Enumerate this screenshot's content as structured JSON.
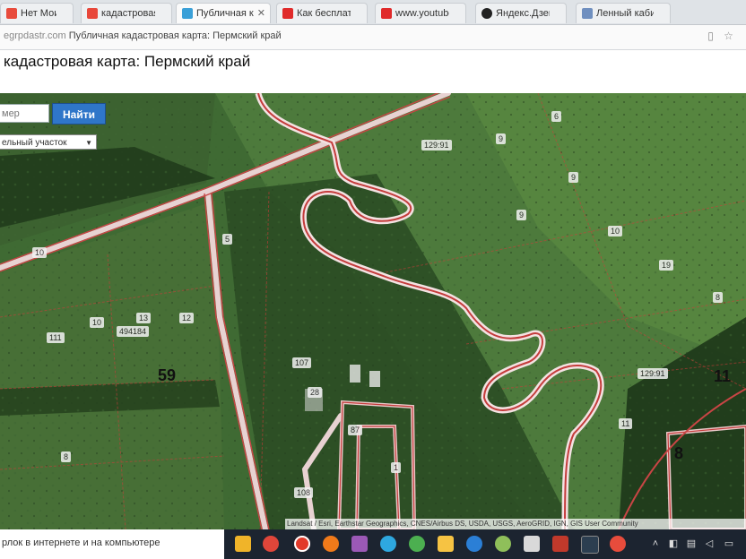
{
  "browser": {
    "tabs": [
      {
        "label": "Нет Моих Жн",
        "icon_color": "#e84b3c",
        "active": false
      },
      {
        "label": "кадастровая карта",
        "icon_color": "#e8473a",
        "active": false
      },
      {
        "label": "Публичная ка",
        "icon_color": "#3aa0d8",
        "active": true
      },
      {
        "label": "Как бесплатно",
        "icon_color": "#e02a2a",
        "active": false
      },
      {
        "label": "www.youtube.co",
        "icon_color": "#e02a2a",
        "active": false
      },
      {
        "label": "Яндекс.Дзен",
        "icon_color": "#222222",
        "active": false
      },
      {
        "label": "Ленный кабин",
        "icon_color": "#6f8fbf",
        "active": false
      }
    ],
    "url_host": "egrpdastr.com",
    "url_text": "Публичная кадастровая карта: Пермский край"
  },
  "page": {
    "title": "кадастровая карта: Пермский край"
  },
  "map": {
    "search_placeholder": "мер",
    "search_button": "Найти",
    "object_type": "ельный участок",
    "labels": [
      {
        "text": "129:91"
      },
      {
        "text": "6"
      },
      {
        "text": "9"
      },
      {
        "text": "9"
      },
      {
        "text": "9"
      },
      {
        "text": "10"
      },
      {
        "text": "19"
      },
      {
        "text": "8"
      },
      {
        "text": "5"
      },
      {
        "text": "10"
      },
      {
        "text": "13"
      },
      {
        "text": "10"
      },
      {
        "text": "494184"
      },
      {
        "text": "12"
      },
      {
        "text": "111"
      },
      {
        "text": "107"
      },
      {
        "text": "28"
      },
      {
        "text": "1"
      },
      {
        "text": "11"
      },
      {
        "text": "129:91"
      },
      {
        "text": "8"
      },
      {
        "text": "87"
      },
      {
        "text": "108"
      },
      {
        "text": "59"
      },
      {
        "text": "8"
      },
      {
        "text": "11"
      }
    ],
    "big_number": "59",
    "attribution": "Landsat / Esri, Earthstar Geographics, CNES/Airbus DS, USDA, USGS, AeroGRID, IGN, GIS User Community"
  },
  "status_text": "рлок в интернете и на компьютере",
  "taskbar": {
    "icons": [
      {
        "name": "folder-icon",
        "color": "#f0b429"
      },
      {
        "name": "chrome-icon",
        "color": "#e0463a"
      },
      {
        "name": "yandex-browser-icon",
        "color": "#e23a2a"
      },
      {
        "name": "firefox-icon",
        "color": "#f07a1a"
      },
      {
        "name": "app-icon-5",
        "color": "#9b59b6"
      },
      {
        "name": "app-icon-6",
        "color": "#2ea8e0"
      },
      {
        "name": "app-icon-7",
        "color": "#4caf50"
      },
      {
        "name": "app-icon-8",
        "color": "#f6c343"
      },
      {
        "name": "edge-icon",
        "color": "#2b7fd6"
      },
      {
        "name": "app-icon-10",
        "color": "#8fbf5a"
      },
      {
        "name": "app-icon-11",
        "color": "#d9d9d9"
      },
      {
        "name": "filezilla-icon",
        "color": "#c0392b"
      },
      {
        "name": "app-icon-13",
        "color": "#2c3e50"
      },
      {
        "name": "app-icon-14",
        "color": "#e74c3c"
      }
    ]
  }
}
